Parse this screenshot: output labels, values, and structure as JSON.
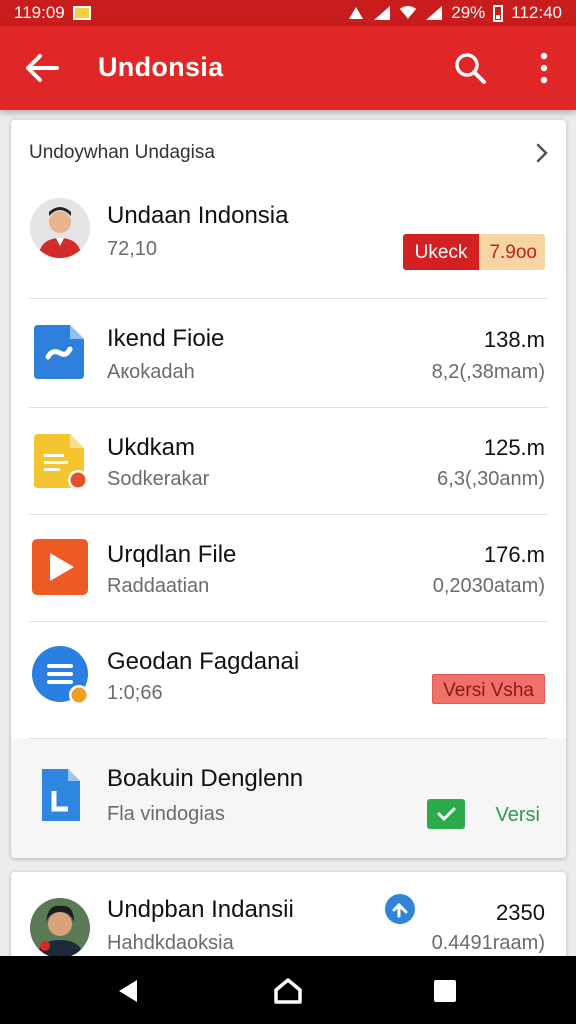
{
  "status_bar": {
    "time_left": "119:09",
    "battery": "29%",
    "time_right": "112:40"
  },
  "app_bar": {
    "title": "Undonsia",
    "back_icon": "arrow-left-icon",
    "search_icon": "search-icon",
    "more_icon": "more-vert-icon"
  },
  "colors": {
    "primary": "#e02626",
    "status": "#c91c1c",
    "accent_green": "#2bab4a",
    "accent_blue": "#2f86d8"
  },
  "card": {
    "header": "Undoywhan Undagisa",
    "rows": [
      {
        "name": "Undaan Indonsia",
        "sub": "72,10",
        "badge_left": "Ukeck",
        "badge_right": "7.9oo"
      },
      {
        "name": "Ikend Fioie",
        "sub": "Aкokadah",
        "size": "138.m",
        "date": "8,2(,38mam)"
      },
      {
        "name": "Ukdkam",
        "sub": "Sodkerakar",
        "size": "125.m",
        "date": "6,3(,30anm)"
      },
      {
        "name": "Urqdlan File",
        "sub": "Raddaatian",
        "size": "176.m",
        "date": "0,2030atam)"
      },
      {
        "name": "Geodan Fagdanai",
        "sub": "1:0;66",
        "badge": "Versi Vsha"
      },
      {
        "name": "Boakuin Denglenn",
        "sub": "Fla vindogias",
        "status": "Versi"
      }
    ]
  },
  "bottom_card": {
    "name": "Undpban Indansii",
    "sub": "Hahdkdaoksia",
    "size": "2350",
    "date": "0.4491raam)"
  },
  "nav": {
    "back": "nav-back-icon",
    "home": "nav-home-icon",
    "recents": "nav-recents-icon"
  }
}
